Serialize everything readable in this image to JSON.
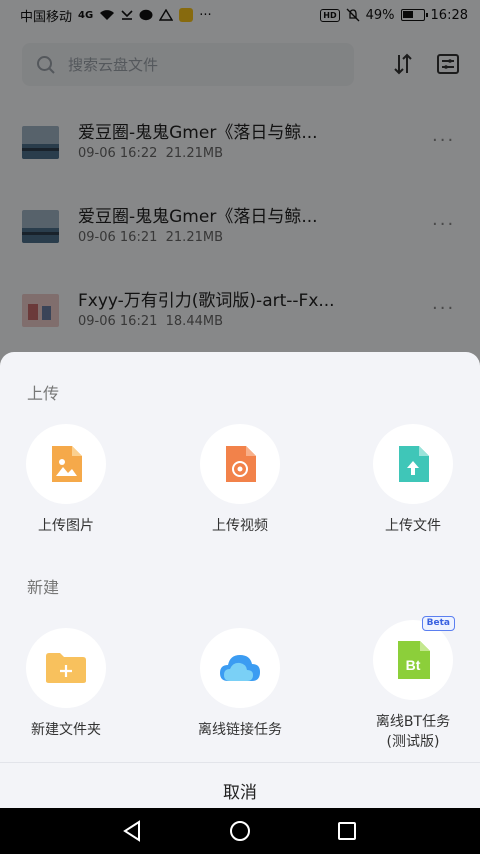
{
  "status_bar": {
    "carrier": "中国移动",
    "signal": "4G",
    "ellipsis": "···",
    "hd": "HD",
    "battery": "49%",
    "time": "16:28"
  },
  "search": {
    "placeholder": "搜索云盘文件"
  },
  "files": [
    {
      "name": "爱豆圈-鬼鬼Gmer《落日与鲸...",
      "date": "09-06 16:22",
      "size": "21.21MB"
    },
    {
      "name": "爱豆圈-鬼鬼Gmer《落日与鲸...",
      "date": "09-06 16:21",
      "size": "21.21MB"
    },
    {
      "name": "Fxyy-万有引力(歌词版)-art--Fx...",
      "date": "09-06 16:21",
      "size": "18.44MB"
    }
  ],
  "sheet": {
    "upload_title": "上传",
    "upload_image": "上传图片",
    "upload_video": "上传视频",
    "upload_file": "上传文件",
    "new_title": "新建",
    "new_folder": "新建文件夹",
    "offline_link": "离线链接任务",
    "offline_bt_line1": "离线BT任务",
    "offline_bt_line2": "(测试版)",
    "beta": "Beta",
    "bt_icon_text": "Bt",
    "cancel": "取消"
  },
  "colors": {
    "image_icon": "#f5a94a",
    "video_icon": "#f2824a",
    "file_icon": "#3fc6b8",
    "folder_icon": "#f8c15d",
    "cloud_icon": "#3b9cf2",
    "bt_icon": "#8ccf3a"
  }
}
